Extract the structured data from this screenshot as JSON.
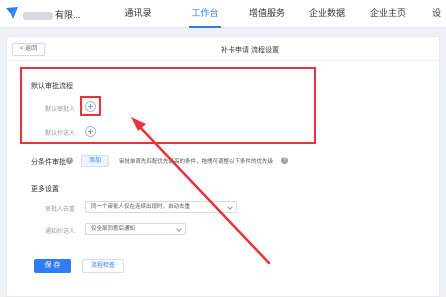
{
  "header": {
    "company_suffix": "有限...",
    "tabs": [
      {
        "label": "通讯录",
        "active": false
      },
      {
        "label": "工作台",
        "active": true
      },
      {
        "label": "增值服务",
        "active": false
      },
      {
        "label": "企业数据",
        "active": false
      },
      {
        "label": "企业主页",
        "active": false
      },
      {
        "label": "设",
        "active": false
      }
    ]
  },
  "toolbar": {
    "back_label": "< 返回",
    "page_title": "补卡申请 流程设置"
  },
  "default_flow": {
    "title": "默认审批流程",
    "approver_label": "默认审批人",
    "cc_label": "默认抄送人"
  },
  "conditional": {
    "title": "分条件审批",
    "add_label": "添加",
    "description": "审批单首先匹配优先级高的条件，拖拽可调整以下条件的优先级"
  },
  "more_settings": {
    "title": "更多设置",
    "dedupe_label": "审批人去重",
    "dedupe_value": "同一个审批人仅在连续出现时，自动去重",
    "notify_label": "通知抄送人",
    "notify_value": "仅全部同意后通知"
  },
  "footer": {
    "save_label": "保 存",
    "check_label": "流程检查"
  },
  "colors": {
    "accent": "#2f7cf6",
    "highlight": "#e8323c"
  }
}
